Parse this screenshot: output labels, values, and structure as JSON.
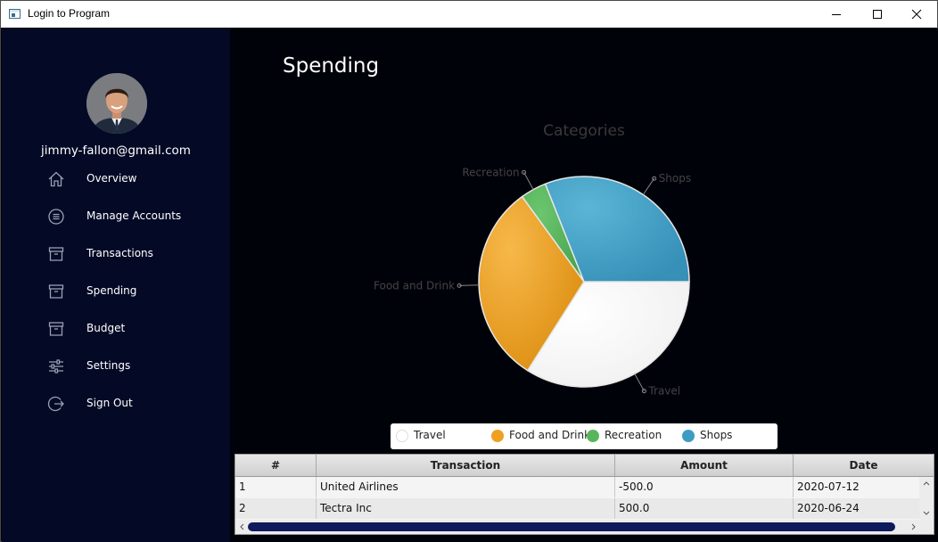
{
  "window": {
    "title": "Login to Program"
  },
  "sidebar": {
    "email": "jimmy-fallon@gmail.com",
    "items": [
      {
        "label": "Overview",
        "icon": "home-icon"
      },
      {
        "label": "Manage Accounts",
        "icon": "list-circle-icon"
      },
      {
        "label": "Transactions",
        "icon": "archive-box-icon"
      },
      {
        "label": "Spending",
        "icon": "archive-box-icon"
      },
      {
        "label": "Budget",
        "icon": "archive-box-icon"
      },
      {
        "label": "Settings",
        "icon": "sliders-icon"
      },
      {
        "label": "Sign Out",
        "icon": "sign-out-icon"
      }
    ]
  },
  "main": {
    "title": "Spending"
  },
  "chart_data": {
    "type": "pie",
    "title": "Categories",
    "slices": [
      {
        "label": "Travel",
        "percent": 34,
        "color": "#ffffff"
      },
      {
        "label": "Food and Drink",
        "percent": 31,
        "color": "#f0a020"
      },
      {
        "label": "Recreation",
        "percent": 4,
        "color": "#59b55c"
      },
      {
        "label": "Shops",
        "percent": 31,
        "color": "#3d9cc4"
      }
    ],
    "legend_position": "bottom"
  },
  "table": {
    "columns": [
      "#",
      "Transaction",
      "Amount",
      "Date"
    ],
    "rows": [
      [
        "1",
        "United Airlines",
        "-500.0",
        "2020-07-12"
      ],
      [
        "2",
        "Tectra Inc",
        "500.0",
        "2020-06-24"
      ]
    ]
  },
  "colors": {
    "sidebar_bg": "#040a26",
    "main_bg": "#00020a",
    "accent": "#0e1a5c"
  }
}
